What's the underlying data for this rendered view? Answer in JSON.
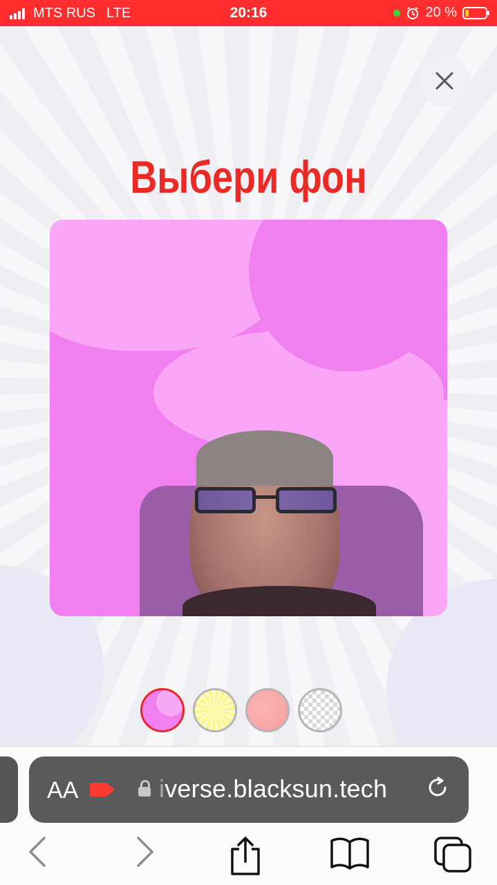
{
  "status_bar": {
    "carrier": "MTS RUS",
    "network": "LTE",
    "time": "20:16",
    "battery": "20 %",
    "battery_level": 0.2,
    "accent_color": "#ff2d2d"
  },
  "page": {
    "title": "Выбери фон",
    "title_color": "#ea2a24",
    "close_icon": "close-icon",
    "backgrounds": [
      {
        "name": "pink",
        "color": "#f27ff0",
        "selected": true
      },
      {
        "name": "yellow",
        "color": "#fff48a",
        "selected": false
      },
      {
        "name": "salmon",
        "color": "#f79e9e",
        "selected": false
      },
      {
        "name": "transparent",
        "color": "#ffffff",
        "selected": false
      }
    ]
  },
  "browser": {
    "text_size_label": "AA",
    "url_faded": "i",
    "url": "verse.blacksun.tech",
    "reload_icon": "reload-icon",
    "toolbar": {
      "back": "‹",
      "forward": "›",
      "share": "share-icon",
      "bookmarks": "bookmarks-icon",
      "tabs": "tabs-icon"
    }
  }
}
